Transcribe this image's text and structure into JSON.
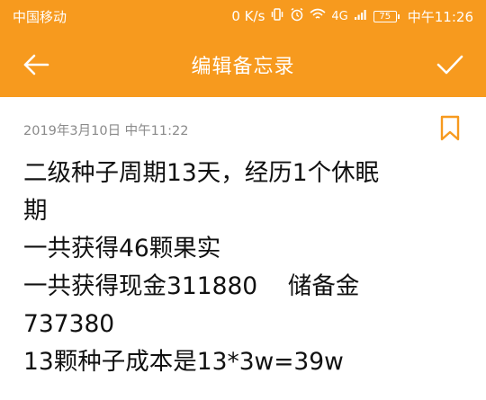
{
  "status_bar": {
    "carrier": "中国移动",
    "speed": "0 K/s",
    "network": "4G",
    "battery": "75",
    "time": "中午11:26",
    "icons": [
      "vibrate-icon",
      "alarm-icon",
      "wifi-icon",
      "signal-icon",
      "battery-icon"
    ]
  },
  "app_bar": {
    "title": "编辑备忘录",
    "back_icon": "arrow-left-icon",
    "confirm_icon": "checkmark-icon"
  },
  "note": {
    "timestamp": "2019年3月10日 中午11:22",
    "bookmark_icon": "bookmark-icon",
    "lines": [
      "二级种子周期13天，经历1个休眠",
      "期",
      "一共获得46颗果实",
      "一共获得现金311880    储备金",
      "737380",
      "13颗种子成本是13*3w=39w"
    ]
  },
  "colors": {
    "accent": "#f79a1e",
    "background": "#ffffff",
    "text": "#111111",
    "muted": "#8a8a8a"
  }
}
